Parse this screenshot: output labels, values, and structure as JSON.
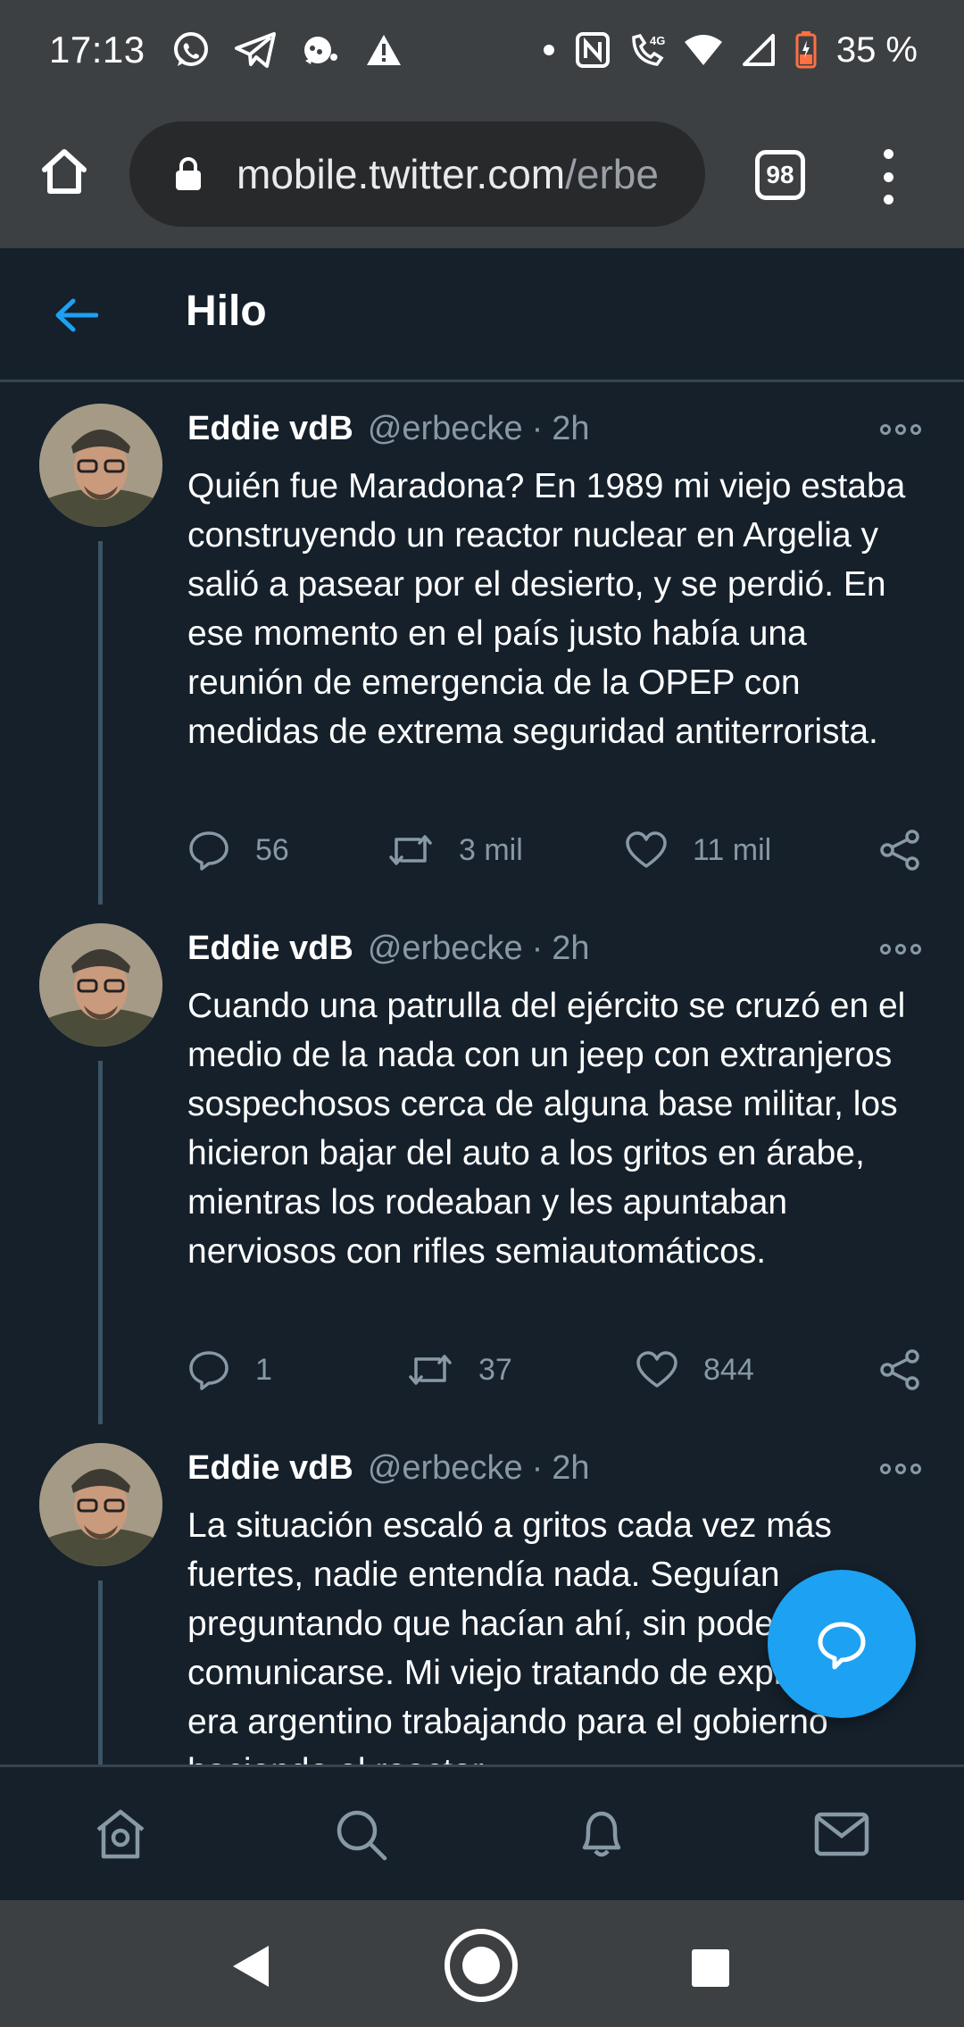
{
  "status_bar": {
    "time": "17:13",
    "battery": "35 %",
    "left_icons": [
      "whatsapp-icon",
      "telegram-icon",
      "notification-icon",
      "warning-icon"
    ],
    "right_icons": [
      "dot-icon",
      "nfc-icon",
      "4g-call-icon",
      "wifi-icon",
      "cell-signal-icon",
      "battery-icon"
    ]
  },
  "browser": {
    "url_domain": "mobile.twitter.com",
    "url_path": "/erbe",
    "tab_count": "98"
  },
  "header": {
    "title": "Hilo"
  },
  "tweets": [
    {
      "name": "Eddie vdB",
      "handle": "@erbecke",
      "separator": "·",
      "time": "2h",
      "text": "Quién fue Maradona? En 1989 mi viejo estaba construyendo un reactor nuclear en Argelia y salió a pasear por el desierto, y se perdió. En ese momento en el país justo había una reunión de emergencia de la OPEP con medidas de extrema seguridad antiterrorista.",
      "replies": "56",
      "retweets": "3 mil",
      "likes": "11 mil"
    },
    {
      "name": "Eddie vdB",
      "handle": "@erbecke",
      "separator": "·",
      "time": "2h",
      "text": "Cuando una patrulla del ejército se cruzó en el medio de la nada con un jeep con extranjeros sospechosos cerca de alguna base militar, los hicieron bajar del auto a los gritos en árabe, mientras los rodeaban y les apuntaban nerviosos con rifles semiautomáticos.",
      "replies": "1",
      "retweets": "37",
      "likes": "844"
    },
    {
      "name": "Eddie vdB",
      "handle": "@erbecke",
      "separator": "·",
      "time": "2h",
      "text": "La situación escaló a gritos cada vez más fuertes, nadie entendía nada. Seguían preguntando que hacían ahí, sin poder comunicarse. Mi viejo tratando de explicar que era argentino trabajando para el gobierno haciendo el reactor."
    }
  ],
  "colors": {
    "background": "#15202b",
    "accent": "#1da1f2",
    "muted": "#8899a6",
    "divider": "#38444d",
    "chrome": "#3c4043"
  }
}
